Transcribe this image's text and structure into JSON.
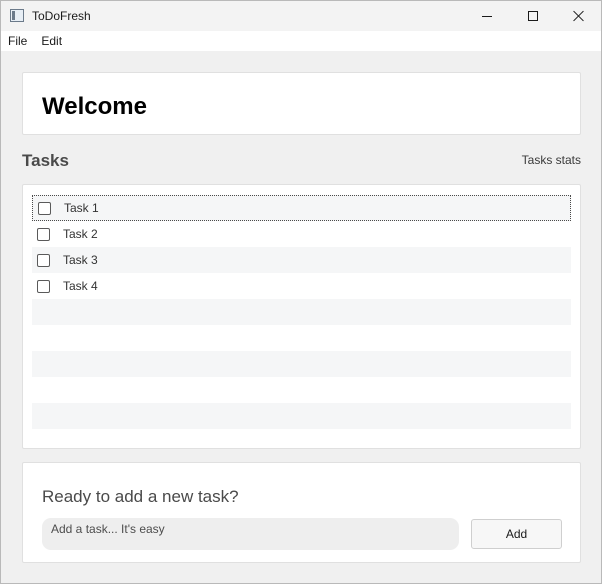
{
  "window": {
    "title": "ToDoFresh",
    "icons": [
      "app-icon",
      "minimize-icon",
      "maximize-icon",
      "close-icon"
    ]
  },
  "menu": {
    "items": [
      "File",
      "Edit"
    ]
  },
  "welcome": {
    "title": "Welcome"
  },
  "tasks": {
    "heading": "Tasks",
    "stats_label": "Tasks stats",
    "items": [
      {
        "label": "Task 1",
        "checked": false,
        "selected": true
      },
      {
        "label": "Task 2",
        "checked": false,
        "selected": false
      },
      {
        "label": "Task 3",
        "checked": false,
        "selected": false
      },
      {
        "label": "Task 4",
        "checked": false,
        "selected": false
      }
    ]
  },
  "add_task": {
    "heading": "Ready to add a new task?",
    "input_placeholder": "Add a task... It's easy",
    "input_value": "",
    "button_label": "Add"
  }
}
